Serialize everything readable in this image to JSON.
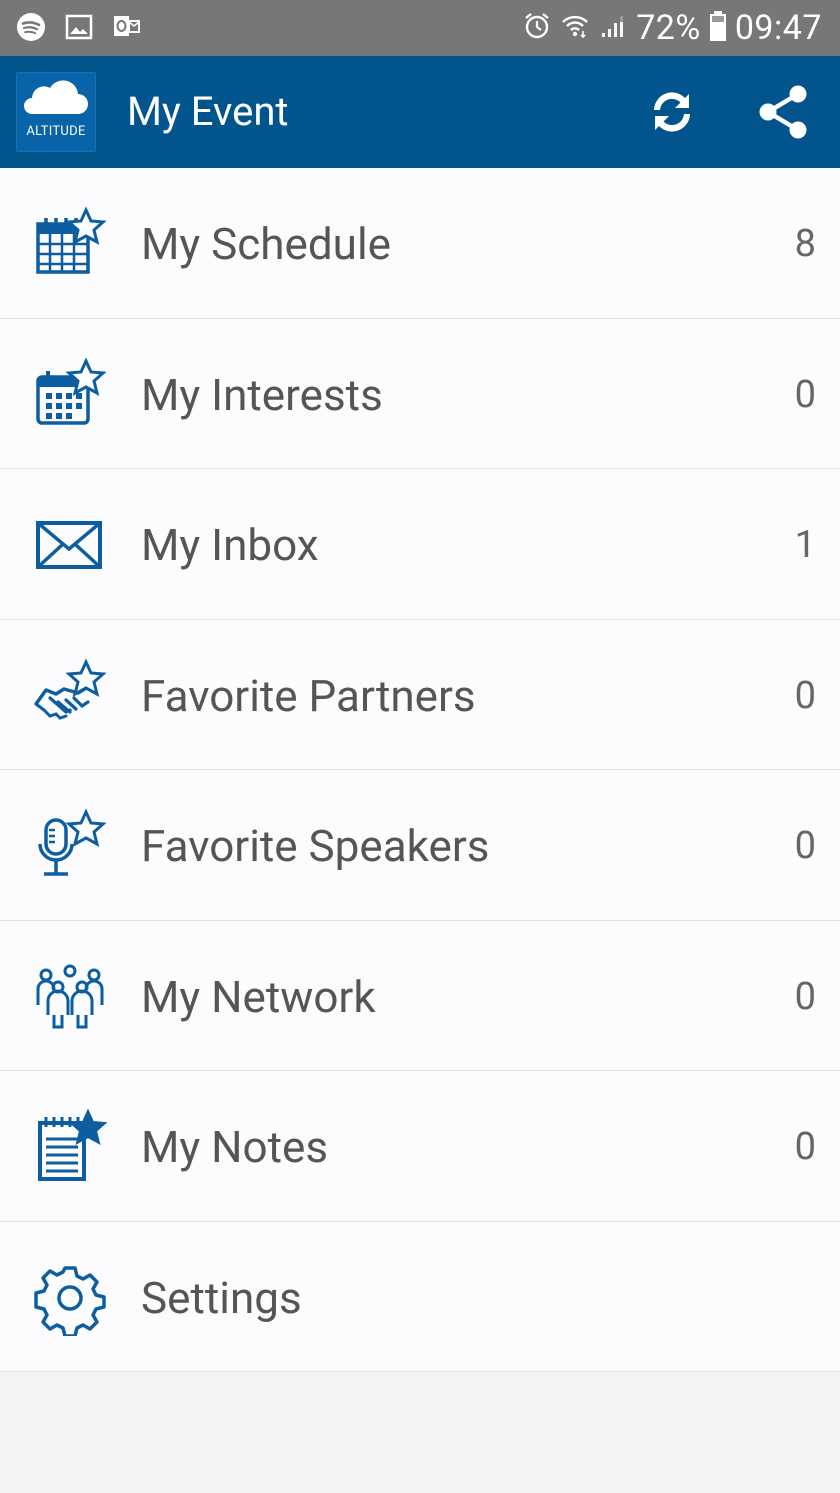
{
  "status_bar": {
    "battery": "72%",
    "time": "09:47",
    "left_icons": [
      "spotify-icon",
      "gallery-icon",
      "outlook-icon"
    ],
    "right_icons": [
      "alarm-icon",
      "wifi-icon",
      "signal-icon",
      "battery-icon"
    ]
  },
  "app_bar": {
    "logo_text": "ALTITUDE",
    "title": "My Event",
    "actions": [
      "sync-icon",
      "share-icon"
    ],
    "color": "#02548c"
  },
  "menu": {
    "icon_color": "#0d5ea0",
    "items": [
      {
        "label": "My Schedule",
        "count": "8",
        "icon": "calendar-star-icon"
      },
      {
        "label": "My Interests",
        "count": "0",
        "icon": "calendar-star-icon"
      },
      {
        "label": "My Inbox",
        "count": "1",
        "icon": "envelope-icon"
      },
      {
        "label": "Favorite Partners",
        "count": "0",
        "icon": "handshake-star-icon"
      },
      {
        "label": "Favorite Speakers",
        "count": "0",
        "icon": "microphone-star-icon"
      },
      {
        "label": "My Network",
        "count": "0",
        "icon": "people-group-icon"
      },
      {
        "label": "My Notes",
        "count": "0",
        "icon": "notepad-star-icon"
      },
      {
        "label": "Settings",
        "count": "",
        "icon": "gear-icon"
      }
    ]
  }
}
